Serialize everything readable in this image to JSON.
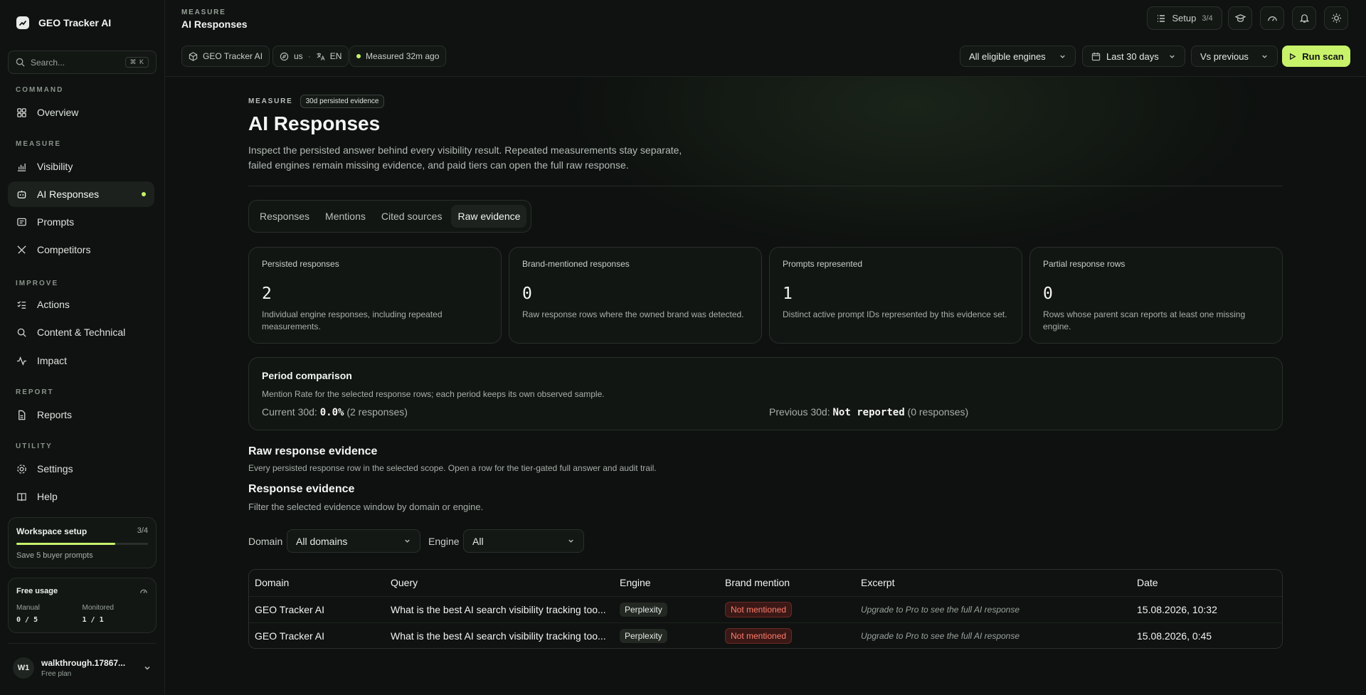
{
  "app": {
    "name": "GEO Tracker AI"
  },
  "sidebar": {
    "search_placeholder": "Search...",
    "search_shortcut": "⌘ K",
    "sections": {
      "command": "COMMAND",
      "measure": "MEASURE",
      "improve": "IMPROVE",
      "report": "REPORT",
      "utility": "UTILITY"
    },
    "items": {
      "overview": "Overview",
      "visibility": "Visibility",
      "ai_responses": "AI Responses",
      "prompts": "Prompts",
      "competitors": "Competitors",
      "actions": "Actions",
      "content_technical": "Content & Technical",
      "impact": "Impact",
      "reports": "Reports",
      "settings": "Settings",
      "help": "Help"
    },
    "workspace_setup": {
      "title": "Workspace setup",
      "count": "3/4",
      "progress": 0.75,
      "subtitle": "Save 5 buyer prompts"
    },
    "free_usage": {
      "title": "Free usage",
      "manual_label": "Manual",
      "manual_value": "0 / 5",
      "monitored_label": "Monitored",
      "monitored_value": "1 / 1"
    },
    "user": {
      "initials": "W1",
      "name": "walkthrough.17867...",
      "plan": "Free plan"
    }
  },
  "topbar": {
    "eyebrow": "MEASURE",
    "title": "AI Responses",
    "setup_label": "Setup",
    "setup_count": "3/4",
    "chips": {
      "project": "GEO Tracker AI",
      "region": "us",
      "lang": "EN",
      "measured": "Measured 32m ago"
    },
    "engine_filter": "All eligible engines",
    "date_filter": "Last 30 days",
    "compare_filter": "Vs previous",
    "run_scan": "Run scan"
  },
  "page": {
    "eyebrow": "MEASURE",
    "badge": "30d persisted evidence",
    "title": "AI Responses",
    "description": "Inspect the persisted answer behind every visibility result. Repeated measurements stay separate, failed engines remain missing evidence, and paid tiers can open the full raw response.",
    "tabs": [
      "Responses",
      "Mentions",
      "Cited sources",
      "Raw evidence"
    ],
    "active_tab": "Raw evidence"
  },
  "stats": [
    {
      "label": "Persisted responses",
      "value": "2",
      "note": "Individual engine responses, including repeated measurements."
    },
    {
      "label": "Brand-mentioned responses",
      "value": "0",
      "note": "Raw response rows where the owned brand was detected."
    },
    {
      "label": "Prompts represented",
      "value": "1",
      "note": "Distinct active prompt IDs represented by this evidence set."
    },
    {
      "label": "Partial response rows",
      "value": "0",
      "note": "Rows whose parent scan reports at least one missing engine."
    }
  ],
  "period": {
    "title": "Period comparison",
    "subtitle": "Mention Rate for the selected response rows; each period keeps its own observed sample.",
    "current_label": "Current 30d:",
    "current_value": "0.0%",
    "current_count": "(2 responses)",
    "previous_label": "Previous 30d:",
    "previous_value": "Not reported",
    "previous_count": "(0 responses)"
  },
  "raw_section": {
    "title": "Raw response evidence",
    "subtitle": "Every persisted response row in the selected scope. Open a row for the tier-gated full answer and audit trail."
  },
  "response_section": {
    "title": "Response evidence",
    "subtitle": "Filter the selected evidence window by domain or engine."
  },
  "filters": {
    "domain_label": "Domain",
    "domain_value": "All domains",
    "engine_label": "Engine",
    "engine_value": "All"
  },
  "table": {
    "columns": [
      "Domain",
      "Query",
      "Engine",
      "Brand mention",
      "Excerpt",
      "Date"
    ],
    "rows": [
      {
        "domain": "GEO Tracker AI",
        "query": "What is the best AI search visibility tracking too...",
        "engine": "Perplexity",
        "mention": "Not mentioned",
        "excerpt": "Upgrade to Pro to see the full AI response",
        "date": "15.08.2026, 10:32"
      },
      {
        "domain": "GEO Tracker AI",
        "query": "What is the best AI search visibility tracking too...",
        "engine": "Perplexity",
        "mention": "Not mentioned",
        "excerpt": "Upgrade to Pro to see the full AI response",
        "date": "15.08.2026, 0:45"
      }
    ]
  },
  "colors": {
    "accent": "#c7f26a",
    "background": "#0e110f",
    "danger": "#ff7d6b"
  }
}
